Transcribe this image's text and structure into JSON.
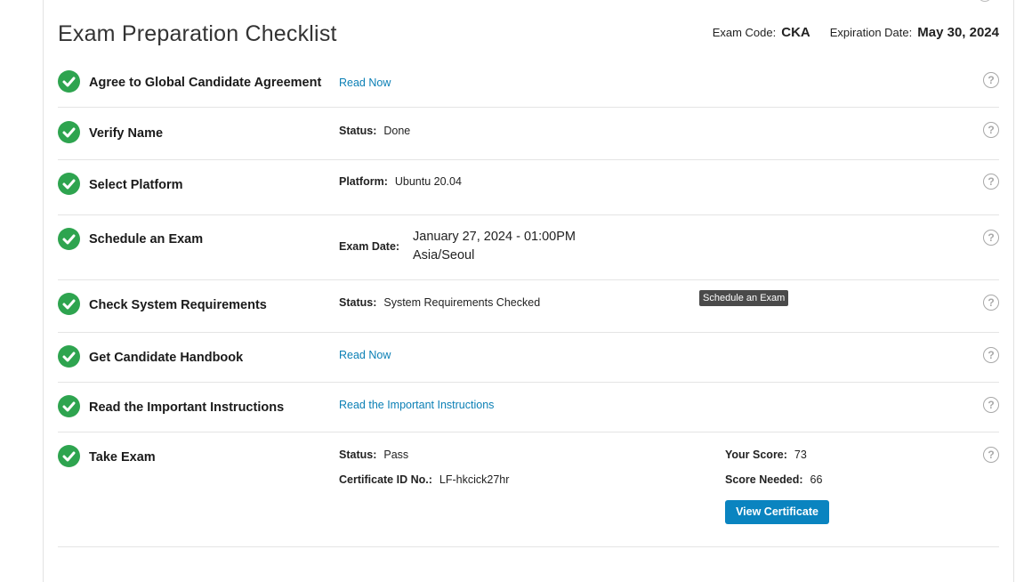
{
  "header": {
    "title": "Exam Preparation Checklist",
    "exam_code_label": "Exam Code:",
    "exam_code": "CKA",
    "expiration_label": "Expiration Date:",
    "expiration_date": "May 30, 2024"
  },
  "steps": [
    {
      "name": "Agree to Global Candidate Agreement",
      "link": "Read Now"
    },
    {
      "name": "Verify Name",
      "status_label": "Status:",
      "status": "Done"
    },
    {
      "name": "Select Platform",
      "platform_label": "Platform:",
      "platform": "Ubuntu 20.04"
    },
    {
      "name": "Schedule an Exam",
      "date_label": "Exam Date:",
      "date_line1": "January 27, 2024 - 01:00PM",
      "date_line2": "Asia/Seoul"
    },
    {
      "name": "Check System Requirements",
      "status_label": "Status:",
      "status": "System Requirements Checked"
    },
    {
      "name": "Get Candidate Handbook",
      "link": "Read Now"
    },
    {
      "name": "Read the Important Instructions",
      "link": "Read the Important Instructions"
    },
    {
      "name": "Take Exam",
      "status_label": "Status:",
      "status": "Pass",
      "cert_label": "Certificate ID No.:",
      "cert_id": "LF-hkcick27hr",
      "score_label": "Your Score:",
      "score": "73",
      "needed_label": "Score Needed:",
      "needed": "66",
      "button": "View Certificate"
    }
  ],
  "tooltip": "Schedule an Exam",
  "help_glyph": "?",
  "colors": {
    "check": "#2ea44f",
    "link": "#0a7fb5",
    "button": "#0a84c0"
  }
}
